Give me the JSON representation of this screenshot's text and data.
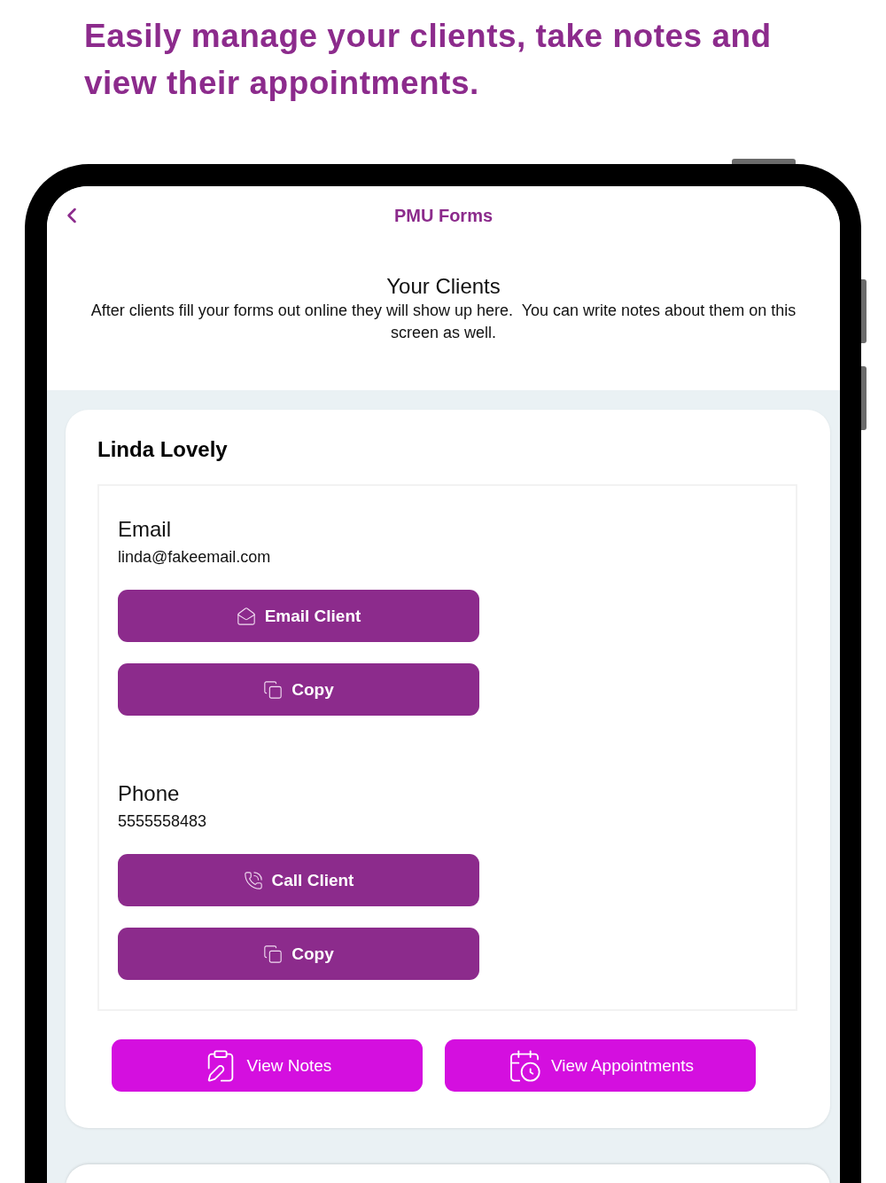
{
  "headline": "Easily manage your clients, take notes and view their appointments.",
  "nav_bar": {
    "title": "PMU Forms"
  },
  "intro": {
    "title": "Your Clients",
    "description": "After clients fill your forms out online they will show up here.  You can write notes about them on this screen as well."
  },
  "clients": [
    {
      "name": "Linda Lovely",
      "contacts": [
        {
          "label": "Email",
          "value": "linda@fakeemail.com",
          "buttons": [
            {
              "kind": "email",
              "label": "Email Client"
            },
            {
              "kind": "copy",
              "label": "Copy"
            }
          ]
        },
        {
          "label": "Phone",
          "value": "5555558483",
          "buttons": [
            {
              "kind": "phone",
              "label": "Call Client"
            },
            {
              "kind": "copy",
              "label": "Copy"
            }
          ]
        }
      ],
      "actions": [
        {
          "kind": "notes",
          "label": "View Notes"
        },
        {
          "kind": "appointments",
          "label": "View Appointments"
        }
      ]
    }
  ]
}
